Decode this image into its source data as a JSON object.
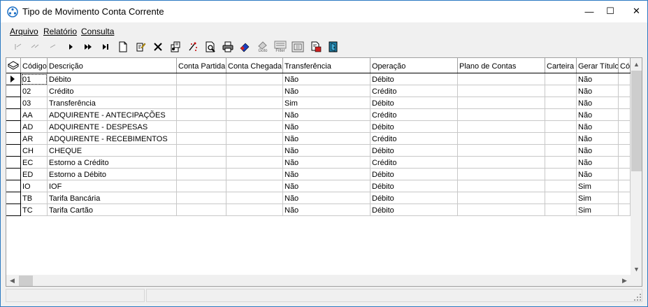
{
  "window": {
    "title": "Tipo de Movimento Conta Corrente",
    "minimize": "—",
    "maximize": "☐",
    "close": "✕"
  },
  "menu": [
    {
      "label": "Arquivo"
    },
    {
      "label": "Relatório"
    },
    {
      "label": "Consulta"
    }
  ],
  "toolbar": {
    "buttons": [
      "first-record-icon",
      "prior-page-icon",
      "prior-record-icon",
      "next-record-icon",
      "next-page-icon",
      "last-record-icon",
      "new-record-icon",
      "edit-record-icon",
      "delete-record-icon",
      "properties-icon",
      "search-tool-icon",
      "preview-icon",
      "print-icon",
      "eraser-icon",
      "goto-icon",
      "filter-icon",
      "filter-off-icon",
      "export-icon",
      "exit-icon"
    ],
    "goto_label": "Goto",
    "filter_label": "Filter"
  },
  "grid": {
    "columns": [
      "Código",
      "Descrição",
      "Conta Partida",
      "Conta Chegada",
      "Transferência",
      "Operação",
      "Plano de Contas",
      "Carteira",
      "Gerar Título",
      "Cód"
    ],
    "rows": [
      {
        "codigo": "01",
        "descricao": "Débito",
        "conta_partida": "",
        "conta_chegada": "",
        "transferencia": "Não",
        "operacao": "Débito",
        "plano": "",
        "carteira": "",
        "gerar_titulo": "Não"
      },
      {
        "codigo": "02",
        "descricao": "Crédito",
        "conta_partida": "",
        "conta_chegada": "",
        "transferencia": "Não",
        "operacao": "Crédito",
        "plano": "",
        "carteira": "",
        "gerar_titulo": "Não"
      },
      {
        "codigo": "03",
        "descricao": "Transferência",
        "conta_partida": "",
        "conta_chegada": "",
        "transferencia": "Sim",
        "operacao": "Débito",
        "plano": "",
        "carteira": "",
        "gerar_titulo": "Não"
      },
      {
        "codigo": "AA",
        "descricao": "ADQUIRENTE - ANTECIPAÇÕES",
        "conta_partida": "",
        "conta_chegada": "",
        "transferencia": "Não",
        "operacao": "Crédito",
        "plano": "",
        "carteira": "",
        "gerar_titulo": "Não"
      },
      {
        "codigo": "AD",
        "descricao": "ADQUIRENTE - DESPESAS",
        "conta_partida": "",
        "conta_chegada": "",
        "transferencia": "Não",
        "operacao": "Débito",
        "plano": "",
        "carteira": "",
        "gerar_titulo": "Não"
      },
      {
        "codigo": "AR",
        "descricao": "ADQUIRENTE - RECEBIMENTOS",
        "conta_partida": "",
        "conta_chegada": "",
        "transferencia": "Não",
        "operacao": "Crédito",
        "plano": "",
        "carteira": "",
        "gerar_titulo": "Não"
      },
      {
        "codigo": "CH",
        "descricao": "CHEQUE",
        "conta_partida": "",
        "conta_chegada": "",
        "transferencia": "Não",
        "operacao": "Débito",
        "plano": "",
        "carteira": "",
        "gerar_titulo": "Não"
      },
      {
        "codigo": "EC",
        "descricao": "Estorno a Crédito",
        "conta_partida": "",
        "conta_chegada": "",
        "transferencia": "Não",
        "operacao": "Crédito",
        "plano": "",
        "carteira": "",
        "gerar_titulo": "Não"
      },
      {
        "codigo": "ED",
        "descricao": "Estorno a Débito",
        "conta_partida": "",
        "conta_chegada": "",
        "transferencia": "Não",
        "operacao": "Débito",
        "plano": "",
        "carteira": "",
        "gerar_titulo": "Não"
      },
      {
        "codigo": "IO",
        "descricao": "IOF",
        "conta_partida": "",
        "conta_chegada": "",
        "transferencia": "Não",
        "operacao": "Débito",
        "plano": "",
        "carteira": "",
        "gerar_titulo": "Sim"
      },
      {
        "codigo": "TB",
        "descricao": "Tarifa Bancária",
        "conta_partida": "",
        "conta_chegada": "",
        "transferencia": "Não",
        "operacao": "Débito",
        "plano": "",
        "carteira": "",
        "gerar_titulo": "Sim"
      },
      {
        "codigo": "TC",
        "descricao": "Tarifa Cartão",
        "conta_partida": "",
        "conta_chegada": "",
        "transferencia": "Não",
        "operacao": "Débito",
        "plano": "",
        "carteira": "",
        "gerar_titulo": "Sim"
      }
    ]
  },
  "scroll": {
    "up": "▲",
    "down": "▼",
    "left": "◀",
    "right": "▶"
  },
  "colors": {
    "window_border": "#2b79c2",
    "chrome": "#f0f0f0",
    "grid_line": "#c8c8c8"
  }
}
